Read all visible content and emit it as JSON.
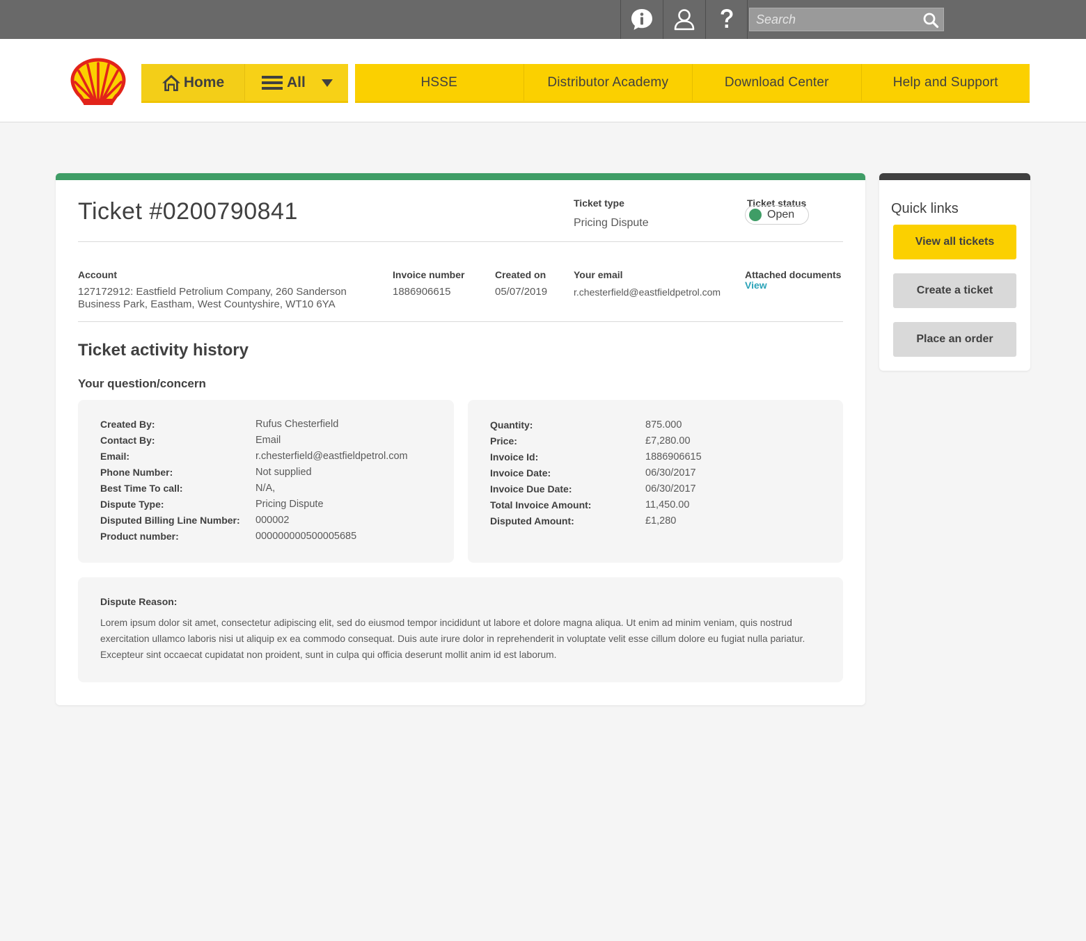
{
  "topbar": {
    "search_placeholder": "Search",
    "icons": [
      "info-icon",
      "user-icon",
      "help-icon",
      "search-icon"
    ]
  },
  "brand": {
    "logo": "shell-logo",
    "accent": "#fbd000",
    "status_green": "#3f9d66",
    "link_teal": "#2ba3b8"
  },
  "nav": {
    "home_label": "Home",
    "all_label": "All",
    "items": [
      "HSSE",
      "Distributor Academy",
      "Download Center",
      "Help and Support"
    ]
  },
  "ticket": {
    "title": "Ticket #0200790841",
    "type_label": "Ticket type",
    "type_value": "Pricing Dispute",
    "status_label": "Ticket status",
    "status_value": "Open",
    "account_label": "Account",
    "account_value": "127172912: Eastfield Petrolium Company, 260 Sanderson Business Park, Eastham, West Countyshire, WT10 6YA",
    "invoice_label": "Invoice number",
    "invoice_value": "1886906615",
    "created_label": "Created on",
    "created_value": "05/07/2019",
    "email_label": "Your email",
    "email_value": "r.chesterfield@eastfieldpetrol.com",
    "docs_label": "Attached documents",
    "docs_link": "View"
  },
  "history": {
    "title": "Ticket activity history",
    "subtitle": "Your question/concern",
    "left_rows": [
      {
        "k": "Created By:",
        "v": "Rufus Chesterfield"
      },
      {
        "k": "Contact By:",
        "v": "Email"
      },
      {
        "k": "Email:",
        "v": "r.chesterfield@eastfieldpetrol.com"
      },
      {
        "k": "Phone Number:",
        "v": "Not supplied"
      },
      {
        "k": "Best Time To call:",
        "v": "N/A,"
      },
      {
        "k": "Dispute Type:",
        "v": "Pricing Dispute"
      },
      {
        "k": "Disputed Billing Line Number:",
        "v": "000002"
      },
      {
        "k": "Product number:",
        "v": "000000000500005685"
      }
    ],
    "right_rows": [
      {
        "k": "Quantity:",
        "v": "875.000"
      },
      {
        "k": "Price:",
        "v": "£7,280.00"
      },
      {
        "k": "Invoice Id:",
        "v": "1886906615"
      },
      {
        "k": "Invoice Date:",
        "v": "06/30/2017"
      },
      {
        "k": "Invoice Due Date:",
        "v": "06/30/2017"
      },
      {
        "k": "Total Invoice Amount:",
        "v": "11,450.00"
      },
      {
        "k": "Disputed Amount:",
        "v": "£1,280"
      }
    ],
    "reason_label": "Dispute Reason:",
    "reason_text": "Lorem ipsum dolor sit amet, consectetur adipiscing elit, sed do eiusmod tempor incididunt ut labore et dolore magna aliqua. Ut enim ad minim veniam, quis nostrud exercitation ullamco laboris nisi ut aliquip ex ea commodo consequat. Duis aute irure dolor in reprehenderit in voluptate velit esse cillum dolore eu fugiat nulla pariatur. Excepteur sint occaecat cupidatat non proident, sunt in culpa qui officia deserunt mollit anim id est laborum."
  },
  "quick_links": {
    "title": "Quick links",
    "view_all": "View all tickets",
    "create": "Create a ticket",
    "order": "Place an order"
  }
}
